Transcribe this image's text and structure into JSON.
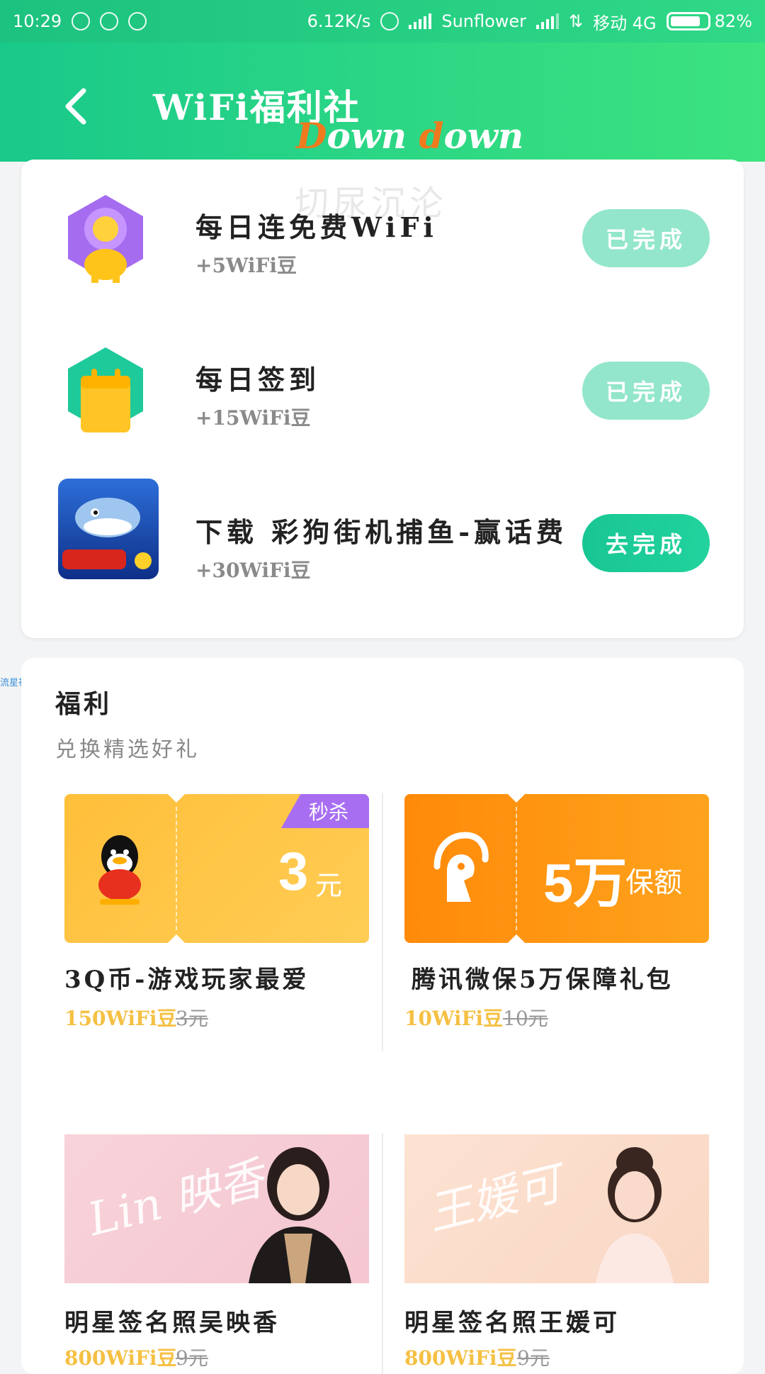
{
  "status_bar": {
    "time": "10:29",
    "network_speed": "6.12K/s",
    "carrier1": "Sunflower",
    "carrier2": "移动 4G",
    "battery": "82%",
    "battery_level": 0.82
  },
  "header": {
    "title": "WiFi福利社",
    "watermark_down_1": "D",
    "watermark_down_2": "own ",
    "watermark_down_3": "d",
    "watermark_down_4": "own"
  },
  "watermark": "切尿沉沦",
  "tasks": [
    {
      "title": "每日连免费WiFi",
      "reward": "+5WiFi豆",
      "button": "已完成",
      "status": "done"
    },
    {
      "title": "每日签到",
      "reward": "+15WiFi豆",
      "button": "已完成",
      "status": "done"
    },
    {
      "title": "下载 彩狗街机捕鱼-赢话费",
      "reward": "+30WiFi豆",
      "button": "去完成",
      "status": "todo"
    }
  ],
  "side_label": "流星社区",
  "welfare": {
    "title": "福利",
    "subtitle": "兑换精选好礼",
    "gifts": [
      {
        "name": "3Q币-游戏玩家最爱",
        "price": "150WiFi豆",
        "old_price": "3元",
        "coupon_value": "3",
        "coupon_unit": "元",
        "tag": "秒杀",
        "icon": "qq-penguin-icon"
      },
      {
        "name": "腾讯微保5万保障礼包",
        "price": "10WiFi豆",
        "old_price": "10元",
        "coupon_value": "5万",
        "coupon_unit": "保额",
        "icon": "weibao-horse-icon"
      },
      {
        "name": "明星签名照吴映香",
        "price": "800WiFi豆",
        "old_price": "9元"
      },
      {
        "name": "明星签名照王媛可",
        "price": "800WiFi豆",
        "old_price": "9元"
      }
    ]
  },
  "colors": {
    "brand_green": "#1cc98a",
    "done_button": "#93e6cb",
    "price_gold": "#f5c043"
  }
}
